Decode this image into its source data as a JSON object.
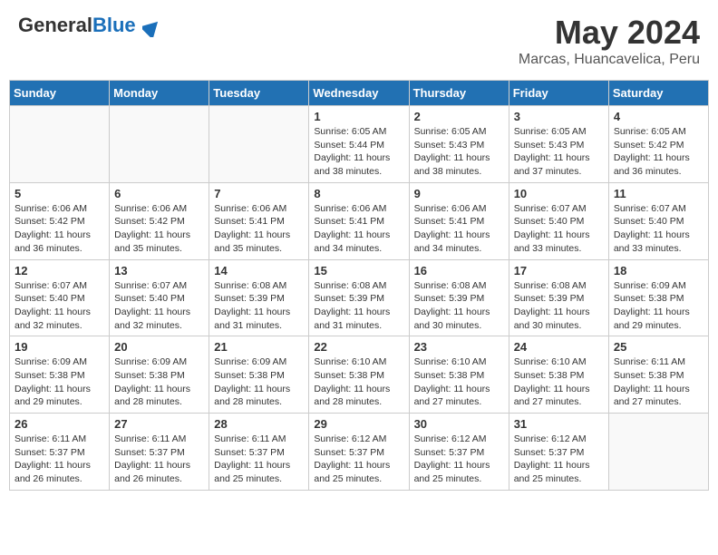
{
  "header": {
    "logo_general": "General",
    "logo_blue": "Blue",
    "month_title": "May 2024",
    "location": "Marcas, Huancavelica, Peru"
  },
  "days_of_week": [
    "Sunday",
    "Monday",
    "Tuesday",
    "Wednesday",
    "Thursday",
    "Friday",
    "Saturday"
  ],
  "weeks": [
    [
      {
        "day": "",
        "sunrise": "",
        "sunset": "",
        "daylight": "",
        "empty": true
      },
      {
        "day": "",
        "sunrise": "",
        "sunset": "",
        "daylight": "",
        "empty": true
      },
      {
        "day": "",
        "sunrise": "",
        "sunset": "",
        "daylight": "",
        "empty": true
      },
      {
        "day": "1",
        "sunrise": "Sunrise: 6:05 AM",
        "sunset": "Sunset: 5:44 PM",
        "daylight": "Daylight: 11 hours and 38 minutes."
      },
      {
        "day": "2",
        "sunrise": "Sunrise: 6:05 AM",
        "sunset": "Sunset: 5:43 PM",
        "daylight": "Daylight: 11 hours and 38 minutes."
      },
      {
        "day": "3",
        "sunrise": "Sunrise: 6:05 AM",
        "sunset": "Sunset: 5:43 PM",
        "daylight": "Daylight: 11 hours and 37 minutes."
      },
      {
        "day": "4",
        "sunrise": "Sunrise: 6:05 AM",
        "sunset": "Sunset: 5:42 PM",
        "daylight": "Daylight: 11 hours and 36 minutes."
      }
    ],
    [
      {
        "day": "5",
        "sunrise": "Sunrise: 6:06 AM",
        "sunset": "Sunset: 5:42 PM",
        "daylight": "Daylight: 11 hours and 36 minutes."
      },
      {
        "day": "6",
        "sunrise": "Sunrise: 6:06 AM",
        "sunset": "Sunset: 5:42 PM",
        "daylight": "Daylight: 11 hours and 35 minutes."
      },
      {
        "day": "7",
        "sunrise": "Sunrise: 6:06 AM",
        "sunset": "Sunset: 5:41 PM",
        "daylight": "Daylight: 11 hours and 35 minutes."
      },
      {
        "day": "8",
        "sunrise": "Sunrise: 6:06 AM",
        "sunset": "Sunset: 5:41 PM",
        "daylight": "Daylight: 11 hours and 34 minutes."
      },
      {
        "day": "9",
        "sunrise": "Sunrise: 6:06 AM",
        "sunset": "Sunset: 5:41 PM",
        "daylight": "Daylight: 11 hours and 34 minutes."
      },
      {
        "day": "10",
        "sunrise": "Sunrise: 6:07 AM",
        "sunset": "Sunset: 5:40 PM",
        "daylight": "Daylight: 11 hours and 33 minutes."
      },
      {
        "day": "11",
        "sunrise": "Sunrise: 6:07 AM",
        "sunset": "Sunset: 5:40 PM",
        "daylight": "Daylight: 11 hours and 33 minutes."
      }
    ],
    [
      {
        "day": "12",
        "sunrise": "Sunrise: 6:07 AM",
        "sunset": "Sunset: 5:40 PM",
        "daylight": "Daylight: 11 hours and 32 minutes."
      },
      {
        "day": "13",
        "sunrise": "Sunrise: 6:07 AM",
        "sunset": "Sunset: 5:40 PM",
        "daylight": "Daylight: 11 hours and 32 minutes."
      },
      {
        "day": "14",
        "sunrise": "Sunrise: 6:08 AM",
        "sunset": "Sunset: 5:39 PM",
        "daylight": "Daylight: 11 hours and 31 minutes."
      },
      {
        "day": "15",
        "sunrise": "Sunrise: 6:08 AM",
        "sunset": "Sunset: 5:39 PM",
        "daylight": "Daylight: 11 hours and 31 minutes."
      },
      {
        "day": "16",
        "sunrise": "Sunrise: 6:08 AM",
        "sunset": "Sunset: 5:39 PM",
        "daylight": "Daylight: 11 hours and 30 minutes."
      },
      {
        "day": "17",
        "sunrise": "Sunrise: 6:08 AM",
        "sunset": "Sunset: 5:39 PM",
        "daylight": "Daylight: 11 hours and 30 minutes."
      },
      {
        "day": "18",
        "sunrise": "Sunrise: 6:09 AM",
        "sunset": "Sunset: 5:38 PM",
        "daylight": "Daylight: 11 hours and 29 minutes."
      }
    ],
    [
      {
        "day": "19",
        "sunrise": "Sunrise: 6:09 AM",
        "sunset": "Sunset: 5:38 PM",
        "daylight": "Daylight: 11 hours and 29 minutes."
      },
      {
        "day": "20",
        "sunrise": "Sunrise: 6:09 AM",
        "sunset": "Sunset: 5:38 PM",
        "daylight": "Daylight: 11 hours and 28 minutes."
      },
      {
        "day": "21",
        "sunrise": "Sunrise: 6:09 AM",
        "sunset": "Sunset: 5:38 PM",
        "daylight": "Daylight: 11 hours and 28 minutes."
      },
      {
        "day": "22",
        "sunrise": "Sunrise: 6:10 AM",
        "sunset": "Sunset: 5:38 PM",
        "daylight": "Daylight: 11 hours and 28 minutes."
      },
      {
        "day": "23",
        "sunrise": "Sunrise: 6:10 AM",
        "sunset": "Sunset: 5:38 PM",
        "daylight": "Daylight: 11 hours and 27 minutes."
      },
      {
        "day": "24",
        "sunrise": "Sunrise: 6:10 AM",
        "sunset": "Sunset: 5:38 PM",
        "daylight": "Daylight: 11 hours and 27 minutes."
      },
      {
        "day": "25",
        "sunrise": "Sunrise: 6:11 AM",
        "sunset": "Sunset: 5:38 PM",
        "daylight": "Daylight: 11 hours and 27 minutes."
      }
    ],
    [
      {
        "day": "26",
        "sunrise": "Sunrise: 6:11 AM",
        "sunset": "Sunset: 5:37 PM",
        "daylight": "Daylight: 11 hours and 26 minutes."
      },
      {
        "day": "27",
        "sunrise": "Sunrise: 6:11 AM",
        "sunset": "Sunset: 5:37 PM",
        "daylight": "Daylight: 11 hours and 26 minutes."
      },
      {
        "day": "28",
        "sunrise": "Sunrise: 6:11 AM",
        "sunset": "Sunset: 5:37 PM",
        "daylight": "Daylight: 11 hours and 25 minutes."
      },
      {
        "day": "29",
        "sunrise": "Sunrise: 6:12 AM",
        "sunset": "Sunset: 5:37 PM",
        "daylight": "Daylight: 11 hours and 25 minutes."
      },
      {
        "day": "30",
        "sunrise": "Sunrise: 6:12 AM",
        "sunset": "Sunset: 5:37 PM",
        "daylight": "Daylight: 11 hours and 25 minutes."
      },
      {
        "day": "31",
        "sunrise": "Sunrise: 6:12 AM",
        "sunset": "Sunset: 5:37 PM",
        "daylight": "Daylight: 11 hours and 25 minutes."
      },
      {
        "day": "",
        "sunrise": "",
        "sunset": "",
        "daylight": "",
        "empty": true
      }
    ]
  ]
}
